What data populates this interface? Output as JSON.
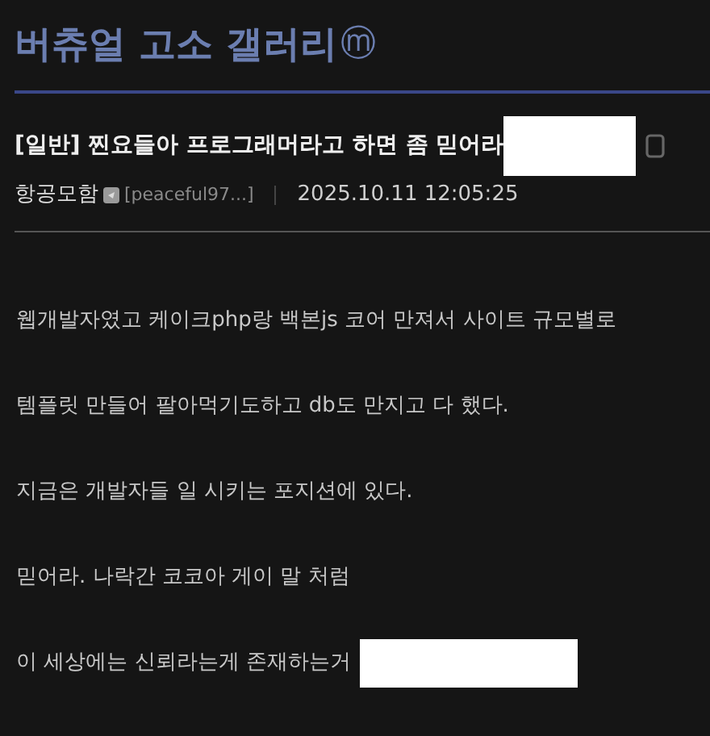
{
  "gallery": {
    "title": "버츄얼 고소 갤러리",
    "badge": "ⓜ"
  },
  "post": {
    "title": "[일반] 찐요들아 프로그래머라고 하면 좀 믿어라",
    "author": "항공모함",
    "author_id": "[peaceful97...]",
    "date": "2025.10.11 12:05:25"
  },
  "body": [
    {
      "text": "웹개발자였고 케이크php랑 백본js 코어 만져서 사이트 규모별로",
      "redacted": false
    },
    {
      "text": "템플릿 만들어 팔아먹기도하고 db도 만지고 다 했다.",
      "redacted": false
    },
    {
      "text": "지금은 개발자들 일 시키는 포지션에 있다.",
      "redacted": false
    },
    {
      "text": "믿어라. 나락간 코코아 게이 말 처럼",
      "redacted": false
    },
    {
      "text": "이 세상에는 신뢰라는게 존재하는거",
      "redacted": true
    }
  ]
}
